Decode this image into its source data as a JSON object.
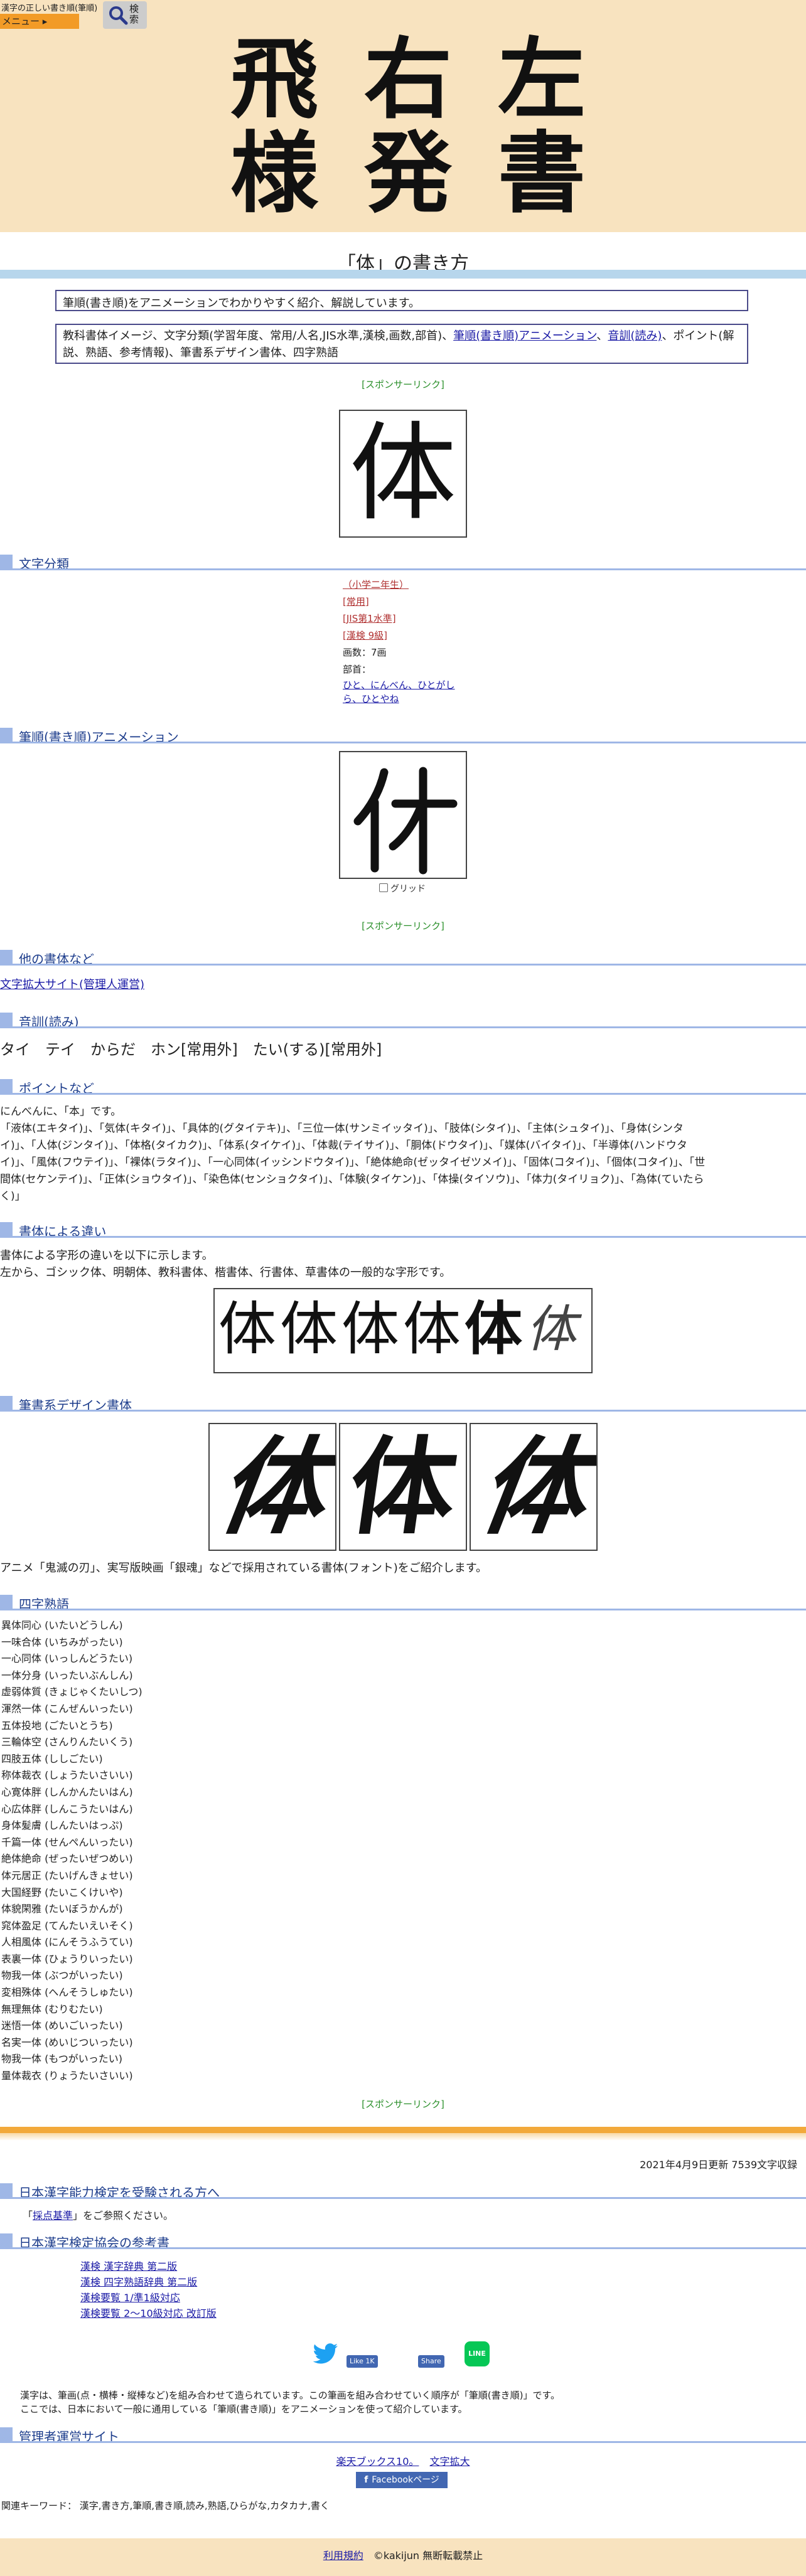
{
  "header": {
    "site_name": "漢字の正しい書き順(筆順)",
    "menu_label": "メニュー ▸",
    "search_label": "検索",
    "logo_chars": [
      "飛",
      "右",
      "左",
      "様",
      "発",
      "書"
    ]
  },
  "page_title": "「体」の書き方",
  "intro": {
    "line1": "筆順(書き順)をアニメーションでわかりやすく紹介、解説しています。",
    "line2_prefix": "教科書体イメージ、文字分類(学習年度、常用/人名,JIS水準,漢検,画数,部首)、",
    "link_anim": "筆順(書き順)アニメーション",
    "sep": "、",
    "link_reading": "音訓(読み)",
    "line2_suffix": "、ポイント(解説、熟語、参考情報)、筆書系デザイン書体、四字熟語"
  },
  "sponsor_label": "[スポンサーリンク]",
  "kanji": "体",
  "sections": {
    "classification": "文字分類",
    "animation": "筆順(書き順)アニメーション",
    "other_fonts": "他の書体など",
    "reading": "音訓(読み)",
    "points": "ポイントなど",
    "font_diff": "書体による違い",
    "design_fonts": "筆書系デザイン書体",
    "idioms": "四字熟語",
    "kentei": "日本漢字能力検定を受験される方へ",
    "references": "日本漢字検定協会の参考書",
    "manager_sites": "管理者運営サイト"
  },
  "classification": {
    "grade": "（小学二年生）",
    "joyo": "[常用]",
    "jis": "[JIS第1水準]",
    "kanken": "[漢検 9級]",
    "strokes": "画数：7画",
    "radical_label": "部首：",
    "radical_line1": "ひと、にんべん、ひとがし",
    "radical_line2": "ら、ひとやね"
  },
  "animation": {
    "grid_label": "グリッド"
  },
  "other_fonts_link": "文字拡大サイト(管理人運営)",
  "reading_text": "タイ　テイ　からだ　ホン[常用外]　たい(する)[常用外]",
  "points": {
    "intro": "にんべんに、「本」です。",
    "line1": "「液体(エキタイ)」、「気体(キタイ)」、「具体的(グタイテキ)」、「三位一体(サンミイッタイ)」、「肢体(シタイ)」、「主体(シュタイ)」、「身体(シンタ",
    "line2": "イ)」、「人体(ジンタイ)」、「体格(タイカク)」、「体系(タイケイ)」、「体裁(テイサイ)」、「胴体(ドウタイ)」、「媒体(バイタイ)」、「半導体(ハンドウタ",
    "line3": "イ)」、「風体(フウテイ)」、「裸体(ラタイ)」、「一心同体(イッシンドウタイ)」、「絶体絶命(ゼッタイゼツメイ)」、「固体(コタイ)」、「個体(コタイ)」、「世",
    "line4": "間体(セケンテイ)」、「正体(ショウタイ)」、「染色体(センショクタイ)」、「体験(タイケン)」、「体操(タイソウ)」、「体力(タイリョク)」、「為体(ていたら",
    "line5": "く)」"
  },
  "font_diff": {
    "line1": "書体による字形の違いを以下に示します。",
    "line2": "左から、ゴシック体、明朝体、教科書体、楷書体、行書体、草書体の一般的な字形です。"
  },
  "design_caption": "アニメ「鬼滅の刃」、実写版映画「銀魂」などで採用されている書体(フォント)をご紹介します。",
  "idioms": [
    "異体同心 (いたいどうしん)",
    "一味合体 (いちみがったい)",
    "一心同体 (いっしんどうたい)",
    "一体分身 (いったいぶんしん)",
    "虚弱体質 (きょじゃくたいしつ)",
    "渾然一体 (こんぜんいったい)",
    "五体投地 (ごたいとうち)",
    "三輪体空 (さんりんたいくう)",
    "四肢五体 (ししごたい)",
    "称体裁衣 (しょうたいさいい)",
    "心寛体胖 (しんかんたいはん)",
    "心広体胖 (しんこうたいはん)",
    "身体髪膚 (しんたいはっぷ)",
    "千篇一体 (せんぺんいったい)",
    "絶体絶命 (ぜったいぜつめい)",
    "体元居正 (たいげんきょせい)",
    "大国経野 (たいこくけいや)",
    "体貌閑雅 (たいぼうかんが)",
    "窕体盈足 (てんたいえいそく)",
    "人相風体 (にんそうふうてい)",
    "表裏一体 (ひょうりいったい)",
    "物我一体 (ぶつがいったい)",
    "変相殊体 (へんそうしゅたい)",
    "無理無体 (むりむたい)",
    "迷悟一体 (めいごいったい)",
    "名実一体 (めいじついったい)",
    "物我一体 (もつがいったい)",
    "量体裁衣 (りょうたいさいい)"
  ],
  "updated": "2021年4月9日更新 7539文字収録",
  "kentei": {
    "link": "採点基準",
    "text": "をご参照ください。",
    "open": "「",
    "close": "」"
  },
  "references": [
    "漢検 漢字辞典 第二版",
    "漢検 四字熟語辞典 第二版",
    "漢検要覧 1/準1級対応",
    "漢検要覧 2～10級対応 改訂版"
  ],
  "social": {
    "like": "Like 1K",
    "share": "Share",
    "line": "LINE"
  },
  "description": {
    "line1": "漢字は、筆画(点・横棒・縦棒など)を組み合わせて造られています。この筆画を組み合わせていく順序が「筆順(書き順)」です。",
    "line2": "ここでは、日本において一般に通用している「筆順(書き順)」をアニメーションを使って紹介しています。"
  },
  "manager_links": [
    "楽天ブックス10。",
    "文字拡大"
  ],
  "facebook_page": "Facebookページ",
  "keywords": "関連キーワード： 漢字,書き方,筆順,書き順,読み,熟語,ひらがな,カタカナ,書く",
  "footer": {
    "terms": "利用規約",
    "copyright": "©kakijun 無断転載禁止"
  },
  "colors": {
    "header_bg": "#f8e3bf",
    "menu_orange": "#f29b27",
    "section_blue": "#9fb7e6",
    "sponsor_green": "#2a8f2a",
    "link_blue": "#1a1aa6"
  }
}
